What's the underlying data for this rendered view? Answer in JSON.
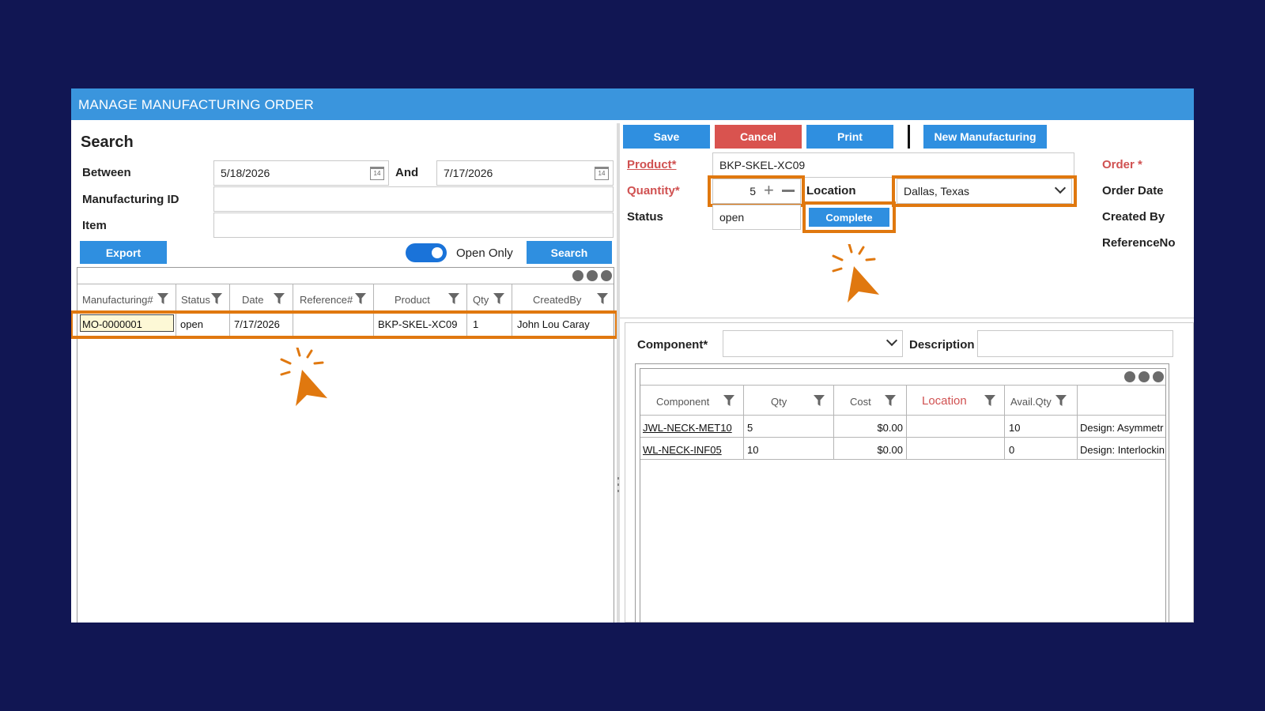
{
  "window": {
    "title": "MANAGE MANUFACTURING ORDER"
  },
  "search": {
    "heading": "Search",
    "between_label": "Between",
    "from_date": "5/18/2026",
    "and_label": "And",
    "to_date": "7/17/2026",
    "calendar_glyph": "14",
    "manufacturing_id_label": "Manufacturing ID",
    "manufacturing_id_value": "",
    "item_label": "Item",
    "item_value": "",
    "export_label": "Export",
    "open_only_label": "Open Only",
    "open_only_on": true,
    "search_label": "Search"
  },
  "results_grid": {
    "columns": [
      "Manufacturing#",
      "Status",
      "Date",
      "Reference#",
      "Product",
      "Qty",
      "CreatedBy"
    ],
    "rows": [
      {
        "manufacturing": "MO-0000001",
        "status": "open",
        "date": "7/17/2026",
        "reference": "",
        "product": "BKP-SKEL-XC09",
        "qty": "1",
        "created_by": "John Lou Caray"
      }
    ]
  },
  "toolbar": {
    "save_label": "Save",
    "cancel_label": "Cancel",
    "print_label": "Print",
    "new_label": "New Manufacturing"
  },
  "order": {
    "product_label": "Product*",
    "product_value": "BKP-SKEL-XC09",
    "quantity_label": "Quantity*",
    "quantity_value": "5",
    "location_label": "Location",
    "location_value": "Dallas, Texas",
    "status_label": "Status",
    "status_value": "open",
    "complete_label": "Complete",
    "order_label": "Order *",
    "order_date_label": "Order Date",
    "created_by_label": "Created By",
    "reference_label": "ReferenceNo"
  },
  "components": {
    "component_label": "Component*",
    "component_value": "",
    "description_label": "Description",
    "description_value": "",
    "columns": [
      "Component",
      "Qty",
      "Cost",
      "Location",
      "Avail.Qty"
    ],
    "rows": [
      {
        "component": "JWL-NECK-MET10",
        "qty": "5",
        "cost": "$0.00",
        "location": "",
        "avail": "10",
        "description": "Design: Asymmetr"
      },
      {
        "component": "WL-NECK-INF05",
        "qty": "10",
        "cost": "$0.00",
        "location": "",
        "avail": "0",
        "description": "Design: Interlockin"
      }
    ]
  },
  "colors": {
    "accent": "#3a95dd",
    "highlight": "#e0780f",
    "cancel": "#d9534f",
    "background": "#111653"
  }
}
